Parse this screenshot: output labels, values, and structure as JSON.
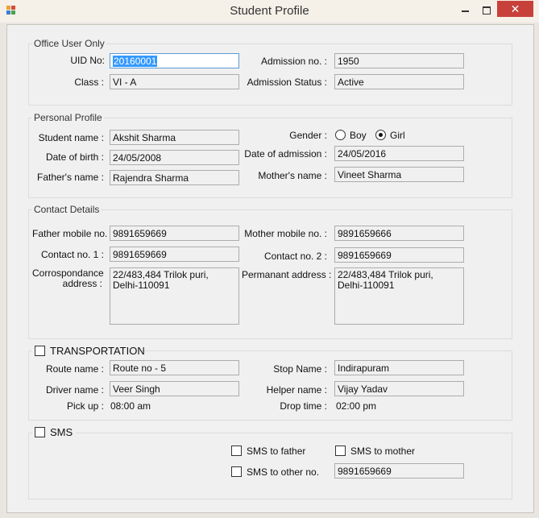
{
  "window": {
    "title": "Student Profile",
    "close_glyph": "✕",
    "controls": [
      "minimize-icon",
      "maximize-icon",
      "close-icon"
    ]
  },
  "office": {
    "title": "Office User Only",
    "uid_label": "UID No:",
    "uid_value": "20160001",
    "class_label": "Class :",
    "class_value": "VI - A",
    "admission_no_label": "Admission no. :",
    "admission_no_value": "1950",
    "admission_status_label": "Admission Status :",
    "admission_status_value": "Active"
  },
  "personal": {
    "title": "Personal Profile",
    "student_name_label": "Student name :",
    "student_name_value": "Akshit Sharma",
    "dob_label": "Date of birth :",
    "dob_value": "24/05/2008",
    "father_label": "Father's name :",
    "father_value": "Rajendra Sharma",
    "gender_label": "Gender :",
    "gender_boy": "Boy",
    "gender_girl": "Girl",
    "gender_selected": "Girl",
    "doa_label": "Date of admission :",
    "doa_value": "24/05/2016",
    "mother_label": "Mother's name :",
    "mother_value": "Vineet Sharma"
  },
  "contact": {
    "title": "Contact Details",
    "father_mobile_label": "Father mobile no. :",
    "father_mobile_value": "9891659669",
    "contact1_label": "Contact no. 1 :",
    "contact1_value": "9891659669",
    "corr_label": "Corrospondance address :",
    "corr_value": "22/483,484 Trilok puri, Delhi-110091",
    "mother_mobile_label": "Mother mobile no. :",
    "mother_mobile_value": "9891659666",
    "contact2_label": "Contact no. 2 :",
    "contact2_value": "9891659669",
    "perm_label": "Permanant address :",
    "perm_value": "22/483,484 Trilok puri, Delhi-110091"
  },
  "transport": {
    "title": "TRANSPORTATION",
    "checked": false,
    "route_label": "Route name :",
    "route_value": "Route no - 5",
    "driver_label": "Driver name :",
    "driver_value": "Veer Singh",
    "pickup_label": "Pick up :",
    "pickup_value": "08:00 am",
    "stop_label": "Stop Name :",
    "stop_value": "Indirapuram",
    "helper_label": "Helper name :",
    "helper_value": "Vijay Yadav",
    "drop_label": "Drop time :",
    "drop_value": "02:00 pm"
  },
  "sms": {
    "title": "SMS",
    "checked": false,
    "to_father": "SMS to father",
    "to_mother": "SMS to mother",
    "to_other": "SMS to other no.",
    "other_value": "9891659669"
  }
}
